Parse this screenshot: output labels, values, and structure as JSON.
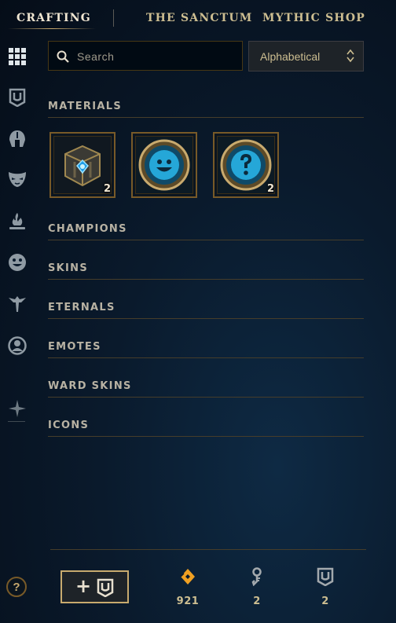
{
  "nav": {
    "tabs": [
      {
        "label": "CRAFTING",
        "icon": "crafting-tab",
        "active": true
      },
      {
        "label": "THE SANCTUM"
      },
      {
        "label": "MYTHIC SHOP"
      }
    ]
  },
  "sidebar": {
    "items": [
      {
        "icon": "grid-icon",
        "active": true
      },
      {
        "icon": "chest-icon"
      },
      {
        "icon": "helmet-icon"
      },
      {
        "icon": "mask-icon"
      },
      {
        "icon": "flame-icon"
      },
      {
        "icon": "emote-face-icon"
      },
      {
        "icon": "ward-icon"
      },
      {
        "icon": "profile-icon"
      },
      {
        "icon": "compass-star-icon"
      }
    ]
  },
  "search": {
    "placeholder": "Search",
    "value": ""
  },
  "sort": {
    "selected": "Alphabetical"
  },
  "sections": {
    "materials": "MATERIALS",
    "champions": "CHAMPIONS",
    "skins": "SKINS",
    "eternals": "ETERNALS",
    "emotes": "EMOTES",
    "ward_skins": "WARD SKINS",
    "icons": "ICONS"
  },
  "materials": [
    {
      "icon": "hextech-chest-icon",
      "count": "2"
    },
    {
      "icon": "smiley-emote-orb-icon",
      "count": ""
    },
    {
      "icon": "mystery-emote-orb-icon",
      "count": "2"
    }
  ],
  "footer": {
    "help": "?",
    "add_button": "+",
    "blue_essence": "921",
    "keys": "2",
    "chests": "2"
  },
  "colors": {
    "gold": "#c8aa6e",
    "gold_dark": "#785a28",
    "orange_essence": "#f0a022",
    "teal": "#0ac8b9",
    "background": "#0a1a2c"
  }
}
